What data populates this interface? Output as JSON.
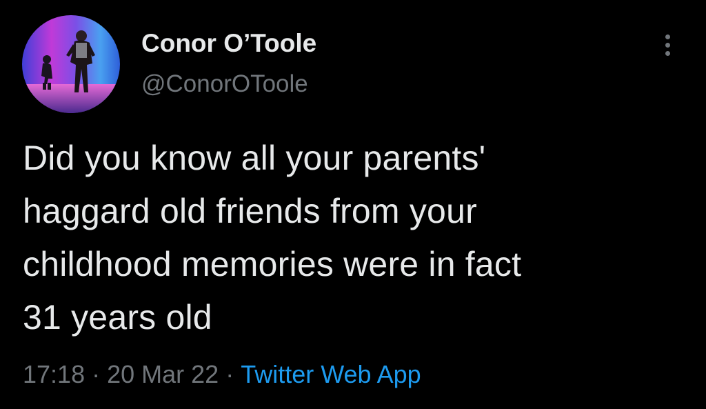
{
  "colors": {
    "background": "#000000",
    "primary_text": "#e7e9ea",
    "secondary_text": "#71767b",
    "link": "#1d9bf0"
  },
  "author": {
    "display_name": "Conor O’Toole",
    "handle": "@ConorOToole",
    "avatar_icon": "profile-photo"
  },
  "menu": {
    "icon": "more-vertical-icon"
  },
  "tweet": {
    "text": "Did you know all your parents'\nhaggard old friends from your\nchildhood memories were in fact\n31 years old"
  },
  "meta": {
    "time": "17:18",
    "separator": "·",
    "date": "20 Mar 22",
    "source": "Twitter Web App"
  }
}
